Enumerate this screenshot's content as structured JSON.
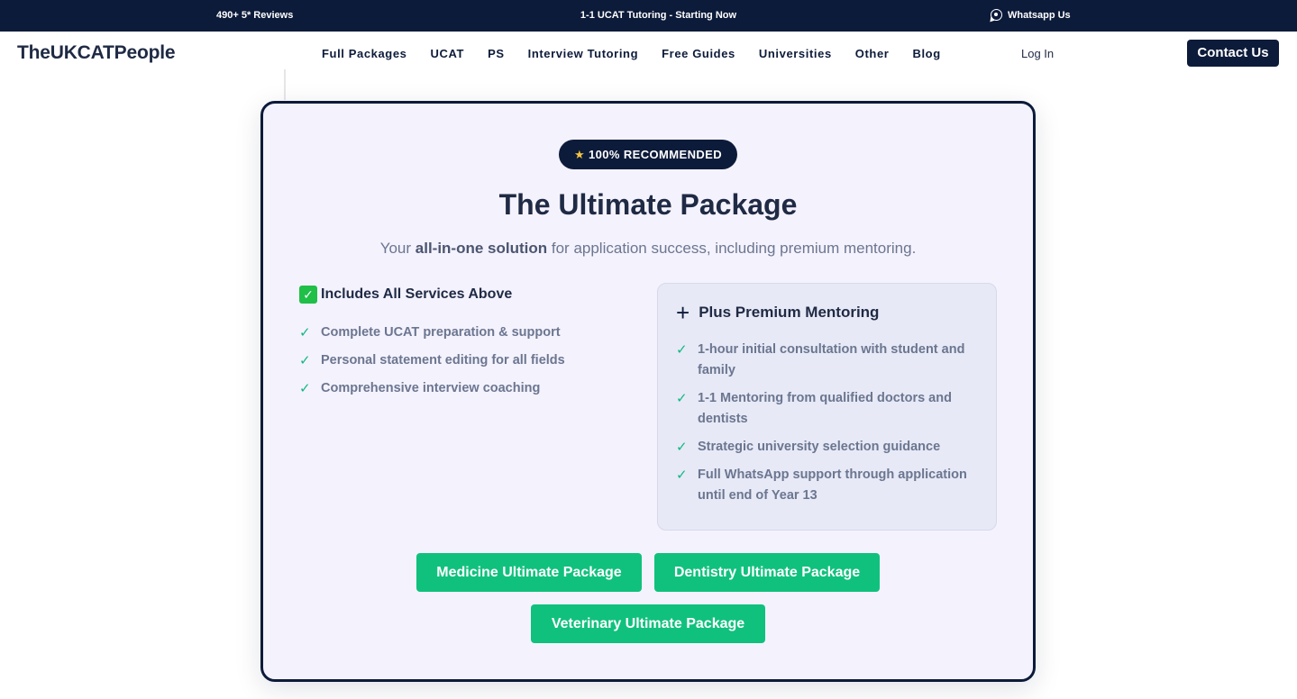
{
  "topbar": {
    "reviews": "490+ 5* Reviews",
    "promo": "1-1 UCAT Tutoring - Starting Now",
    "whatsapp": "Whatsapp Us"
  },
  "nav": {
    "logo": "TheUKCATPeople",
    "items": [
      "Full Packages",
      "UCAT",
      "PS",
      "Interview Tutoring",
      "Free Guides",
      "Universities",
      "Other",
      "Blog"
    ],
    "login": "Log In",
    "contact": "Contact Us"
  },
  "card": {
    "badge": "100% RECOMMENDED",
    "title": "The Ultimate Package",
    "subtitle_pre": "Your ",
    "subtitle_bold": "all-in-one solution",
    "subtitle_post": " for application success, including premium mentoring.",
    "left_heading": "Includes All Services Above",
    "left_items": [
      "Complete UCAT preparation & support",
      "Personal statement editing for all fields",
      "Comprehensive interview coaching"
    ],
    "mentor_heading": "Plus Premium Mentoring",
    "mentor_items": [
      "1-hour initial consultation with student and family",
      "1-1 Mentoring from qualified doctors and dentists",
      "Strategic university selection guidance",
      "Full WhatsApp support through application until end of Year 13"
    ],
    "buttons": {
      "medicine": "Medicine Ultimate Package",
      "dentistry": "Dentistry Ultimate Package",
      "veterinary": "Veterinary Ultimate Package"
    }
  },
  "colors": {
    "navy": "#0d1b3a",
    "green": "#10c17d",
    "card_bg": "#f4f2fd"
  }
}
